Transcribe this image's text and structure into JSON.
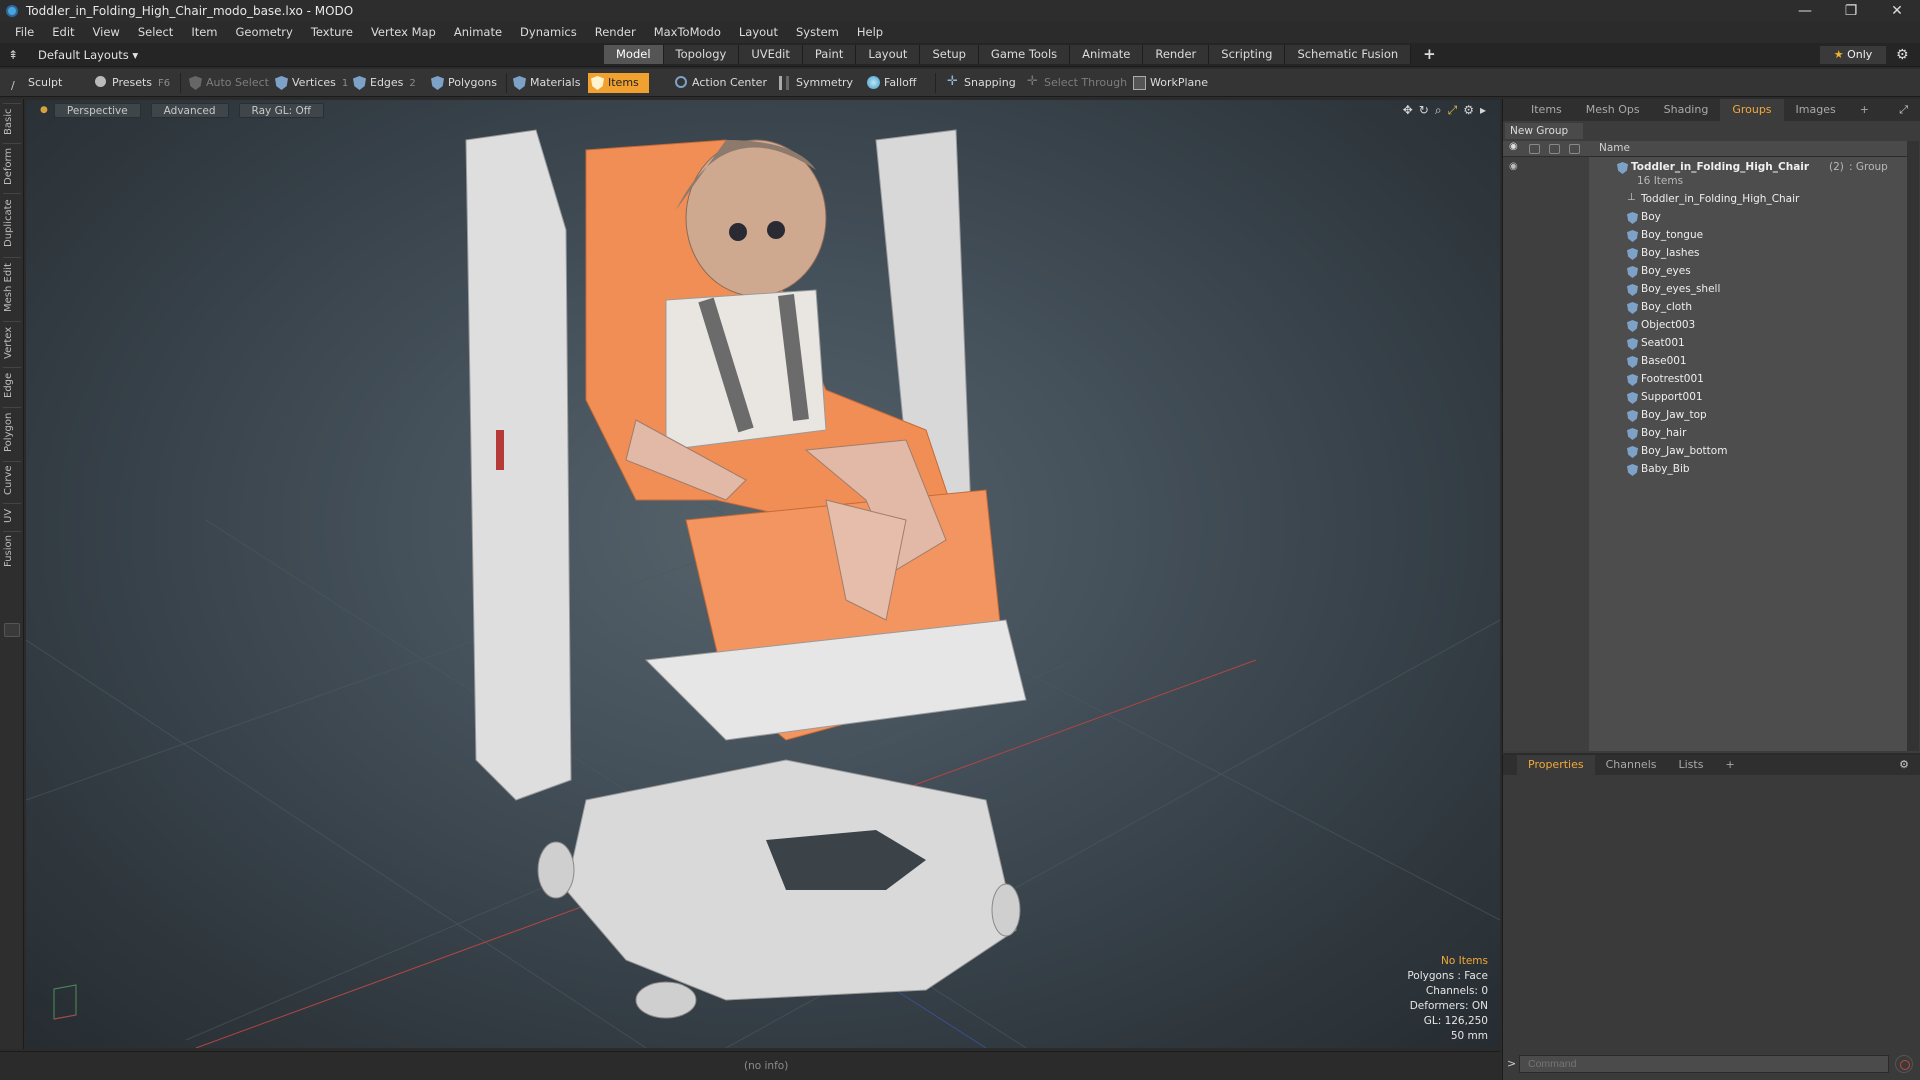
{
  "window": {
    "title": "Toddler_in_Folding_High_Chair_modo_base.lxo - MODO",
    "controls": [
      "—",
      "❐",
      "✕"
    ]
  },
  "menu": [
    "File",
    "Edit",
    "View",
    "Select",
    "Item",
    "Geometry",
    "Texture",
    "Vertex Map",
    "Animate",
    "Dynamics",
    "Render",
    "MaxToModo",
    "Layout",
    "System",
    "Help"
  ],
  "layout": {
    "dropdown": "Default Layouts ▾",
    "tabs": [
      "Model",
      "Topology",
      "UVEdit",
      "Paint",
      "Layout",
      "Setup",
      "Game Tools",
      "Animate",
      "Render",
      "Scripting",
      "Schematic Fusion"
    ],
    "active_tab": "Model",
    "plus": "+",
    "only": "Only"
  },
  "toolbar": {
    "sculpt": "Sculpt",
    "presets": "Presets",
    "presets_key": "F6",
    "auto_select": "Auto Select",
    "vertices": "Vertices",
    "vertices_key": "1",
    "edges": "Edges",
    "edges_key": "2",
    "polygons": "Polygons",
    "materials": "Materials",
    "items": "Items",
    "action_center": "Action Center",
    "symmetry": "Symmetry",
    "falloff": "Falloff",
    "snapping": "Snapping",
    "select_through": "Select Through",
    "workplane": "WorkPlane"
  },
  "lefttabs": [
    "Basic",
    "Deform",
    "Duplicate",
    "Mesh Edit",
    "Vertex",
    "Edge",
    "Polygon",
    "Curve",
    "UV",
    "Fusion"
  ],
  "viewport": {
    "perspective": "Perspective",
    "advanced": "Advanced",
    "raygl": "Ray GL: Off",
    "hud": {
      "no_items": "No Items",
      "polygons": "Polygons : Face",
      "channels": "Channels: 0",
      "deformers": "Deformers: ON",
      "gl": "GL: 126,250",
      "mm": "50 mm"
    }
  },
  "statusbar": {
    "info": "(no info)"
  },
  "panel": {
    "tabs": [
      "Items",
      "Mesh Ops",
      "Shading",
      "Groups",
      "Images",
      "+"
    ],
    "active_tab": "Groups",
    "new_group": "New Group",
    "name_header": "Name",
    "group": {
      "name": "Toddler_in_Folding_High_Chair",
      "count": "(2)",
      "type": ": Group",
      "items_count": "16 Items"
    },
    "items": [
      "Toddler_in_Folding_High_Chair",
      "Boy",
      "Boy_tongue",
      "Boy_lashes",
      "Boy_eyes",
      "Boy_eyes_shell",
      "Boy_cloth",
      "Object003",
      "Seat001",
      "Base001",
      "Footrest001",
      "Support001",
      "Boy_Jaw_top",
      "Boy_hair",
      "Boy_Jaw_bottom",
      "Baby_Bib"
    ]
  },
  "properties": {
    "tabs": [
      "Properties",
      "Channels",
      "Lists",
      "+"
    ],
    "active_tab": "Properties",
    "command_placeholder": "Command"
  },
  "colors": {
    "accent": "#f1a12f",
    "background": "#2b2b2b",
    "viewport_center": "#56636b"
  }
}
